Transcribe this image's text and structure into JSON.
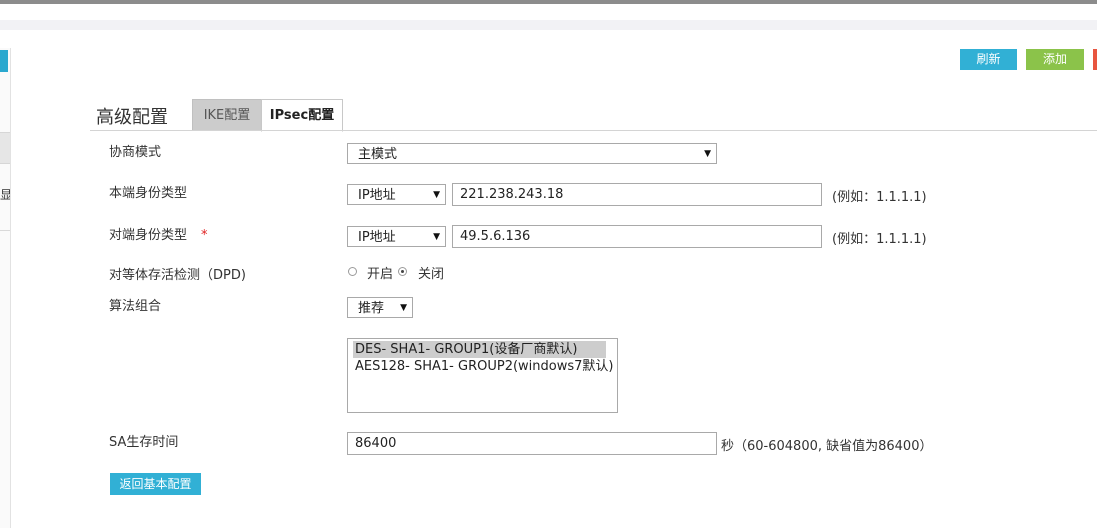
{
  "toolbar": {
    "refresh_label": "刷新",
    "add_label": "添加"
  },
  "left_panel": {
    "partial_char": "显"
  },
  "section": {
    "title": "高级配置"
  },
  "tabs": [
    {
      "label": "IKE配置",
      "active": false
    },
    {
      "label": "IPsec配置",
      "active": true
    }
  ],
  "form": {
    "negotiation_mode": {
      "label": "协商模式",
      "value": "主模式"
    },
    "local_id": {
      "label": "本端身份类型",
      "type": "IP地址",
      "value": "221.238.243.18",
      "hint": "(例如：1.1.1.1)"
    },
    "peer_id": {
      "label": "对端身份类型",
      "required_mark": "*",
      "type": "IP地址",
      "value": "49.5.6.136",
      "hint": "(例如：1.1.1.1)"
    },
    "dpd": {
      "label": "对等体存活检测（DPD)",
      "options": [
        "开启",
        "关闭"
      ],
      "selected": "关闭"
    },
    "algorithm": {
      "label": "算法组合",
      "preset": "推荐",
      "list": [
        {
          "text": "DES- SHA1- GROUP1(设备厂商默认)",
          "selected": true
        },
        {
          "text": "AES128- SHA1- GROUP2(windows7默认)",
          "selected": false
        }
      ]
    },
    "sa_lifetime": {
      "label": "SA生存时间",
      "value": "86400",
      "hint": "秒（60-604800, 缺省值为86400）"
    }
  },
  "back_button_label": "返回基本配置",
  "colors": {
    "accent_blue": "#31b0d5",
    "accent_green": "#8bc34a",
    "accent_red": "#e8553f",
    "required": "#e02020"
  }
}
